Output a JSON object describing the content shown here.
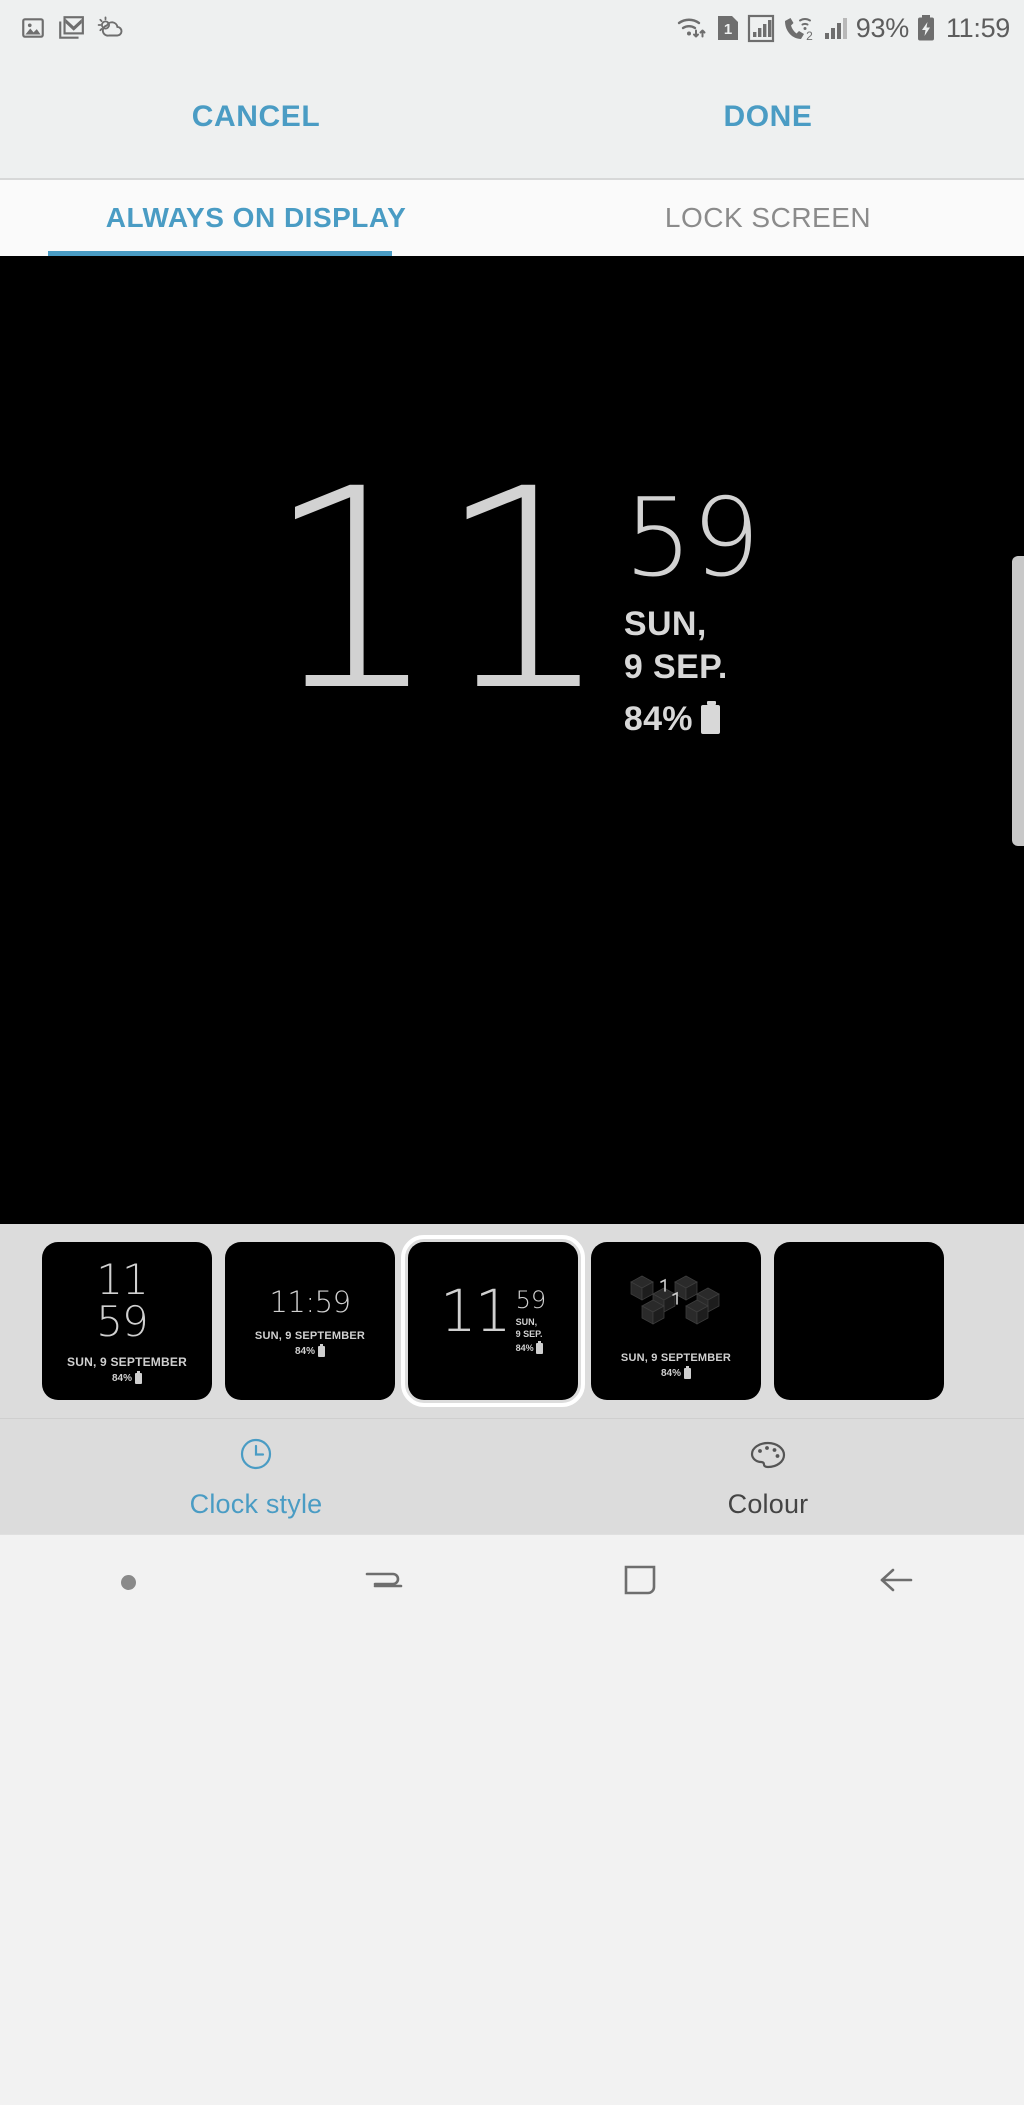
{
  "status_bar": {
    "left_icons": [
      "gallery-icon",
      "gmail-icon",
      "weather-icon"
    ],
    "right_icons": [
      "wifi-icon",
      "sim1-icon",
      "signal-boxed-icon",
      "wifi-calling-2-icon",
      "signal2-icon",
      "battery-charging-icon"
    ],
    "battery_percent": "93%",
    "time": "11:59",
    "sim_badge": "1",
    "call_badge": "2"
  },
  "action_bar": {
    "cancel_label": "CANCEL",
    "done_label": "DONE"
  },
  "tabs": [
    {
      "label": "ALWAYS ON DISPLAY",
      "active": true
    },
    {
      "label": "LOCK SCREEN",
      "active": false
    }
  ],
  "preview": {
    "hour": "11",
    "minute": "59",
    "date_line1": "SUN,",
    "date_line2": "9 SEP.",
    "battery": "84%",
    "battery_icon": "battery-icon",
    "background": "#000000",
    "text_color": "#d2d2d2"
  },
  "clock_styles": [
    {
      "id": "style-stacked",
      "selected": false,
      "hour": "11",
      "minute": "59",
      "date": "SUN, 9 SEPTEMBER",
      "battery": "84%"
    },
    {
      "id": "style-inline",
      "selected": false,
      "time": "11:59",
      "date": "SUN, 9 SEPTEMBER",
      "battery": "84%"
    },
    {
      "id": "style-superscript",
      "selected": true,
      "hour": "11",
      "minute": "59",
      "date_line1": "SUN,",
      "date_line2": "9 SEP.",
      "battery": "84%"
    },
    {
      "id": "style-cube",
      "selected": false,
      "hour": "1",
      "minute": "1",
      "date": "SUN, 9 SEPTEMBER",
      "battery": "84%"
    }
  ],
  "options": [
    {
      "label": "Clock style",
      "icon": "clock-icon",
      "active": true
    },
    {
      "label": "Colour",
      "icon": "palette-icon",
      "active": false
    }
  ],
  "nav_bar": {
    "items": [
      "dot-indicator",
      "recents-icon",
      "home-icon",
      "back-icon"
    ]
  },
  "colors": {
    "accent": "#4a9cc4",
    "status_bg": "#eef0f0",
    "tab_bg": "#fafafa",
    "carousel_bg": "#dcdcdc"
  }
}
